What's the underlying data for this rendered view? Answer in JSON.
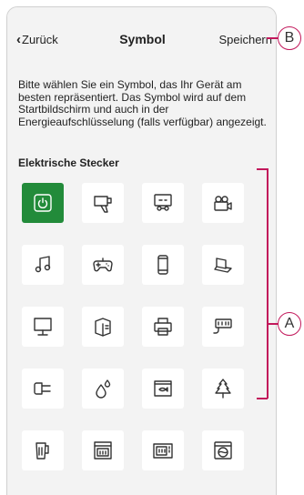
{
  "header": {
    "back_label": "Zurück",
    "title": "Symbol",
    "save_label": "Speichern"
  },
  "description": "Bitte wählen Sie ein Symbol, das Ihr Gerät am besten repräsentiert. Das Symbol wird auf dem Startbildschirm und auch in der Energieaufschlüsselung (falls verfügbar) angezeigt.",
  "section_title": "Elektrische Stecker",
  "selected_icon": "power-icon",
  "icons": [
    "power-icon",
    "hairdryer-icon",
    "game-console-icon",
    "video-camera-icon",
    "music-icon",
    "gamepad-icon",
    "phone-icon",
    "laptop-icon",
    "monitor-icon",
    "computer-tower-icon",
    "printer-icon",
    "power-strip-icon",
    "plug-icon",
    "water-drops-icon",
    "aquarium-icon",
    "christmas-tree-icon",
    "kettle-icon",
    "oven-icon",
    "microwave-icon",
    "washing-machine-icon"
  ],
  "annotations": {
    "callout_b": "B",
    "callout_a": "A"
  },
  "colors": {
    "selected_tile": "#228b3a",
    "callout": "#c2185b"
  }
}
